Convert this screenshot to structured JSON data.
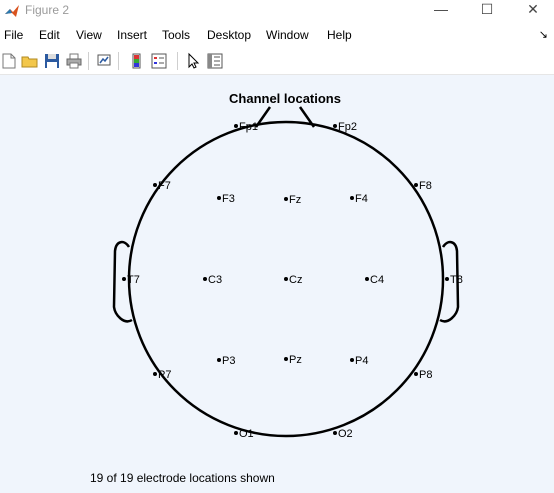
{
  "window": {
    "title": "Figure 2",
    "minimize_glyph": "—",
    "maximize_glyph": "☐",
    "close_glyph": "✕"
  },
  "menu": {
    "items": [
      "File",
      "Edit",
      "View",
      "Insert",
      "Tools",
      "Desktop",
      "Window",
      "Help"
    ],
    "dock_glyph": "↘"
  },
  "toolbar": {
    "buttons": [
      "new-figure-icon",
      "open-file-icon",
      "save-icon",
      "print-icon",
      "link-plot-icon",
      "insert-colorbar-icon",
      "insert-legend-icon",
      "edit-plot-arrow-icon",
      "property-inspector-icon"
    ]
  },
  "plot": {
    "title": "Channel locations",
    "channels": [
      "Fp1",
      "Fp2",
      "F7",
      "F3",
      "Fz",
      "F4",
      "F8",
      "T7",
      "C3",
      "Cz",
      "C4",
      "T8",
      "P7",
      "P3",
      "Pz",
      "P4",
      "P8",
      "O1",
      "O2"
    ],
    "footer": "19 of 19 electrode locations shown"
  },
  "colors": {
    "figure_background": "#f0f5fc",
    "outline": "#000000"
  }
}
